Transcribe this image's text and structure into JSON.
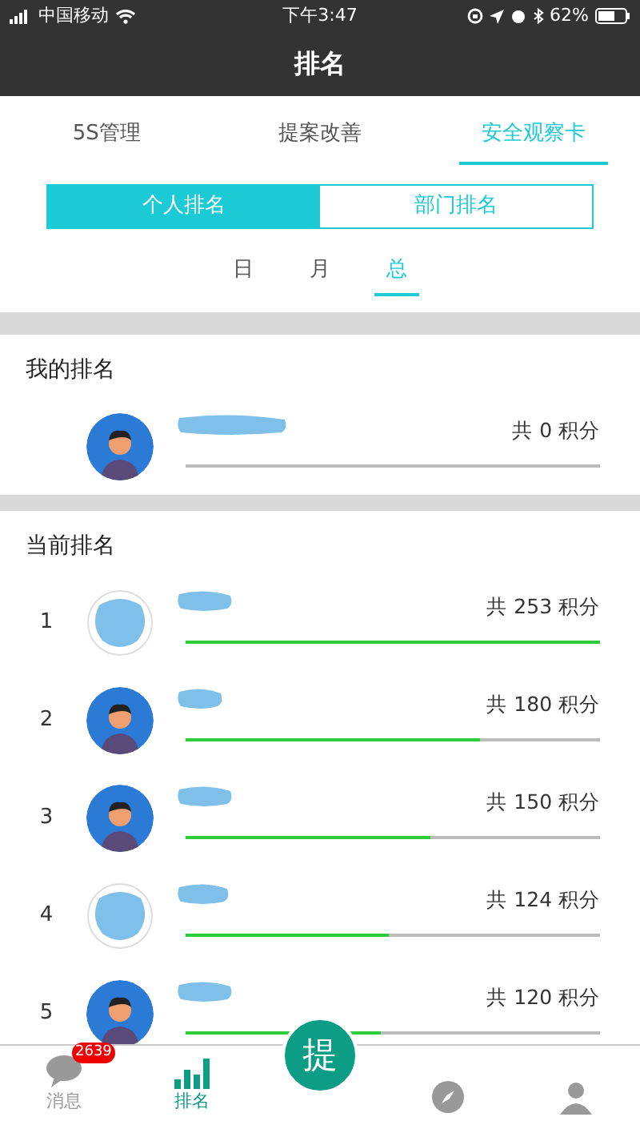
{
  "status_bar": {
    "carrier": "中国移动",
    "time": "下午3:47",
    "battery": "62%"
  },
  "header": {
    "title": "排名"
  },
  "tabs": [
    {
      "label": "5S管理",
      "selected": false
    },
    {
      "label": "提案改善",
      "selected": false
    },
    {
      "label": "安全观察卡",
      "selected": true
    }
  ],
  "segments": [
    {
      "label": "个人排名",
      "selected": true
    },
    {
      "label": "部门排名",
      "selected": false
    }
  ],
  "periods": [
    {
      "label": "日",
      "selected": false
    },
    {
      "label": "月",
      "selected": false
    },
    {
      "label": "总",
      "selected": true
    }
  ],
  "my_ranking": {
    "title": "我的排名",
    "entry": {
      "kind": "person",
      "score": "共 0 积分",
      "level": 0
    }
  },
  "current_ranking": {
    "title": "当前排名",
    "entries": [
      {
        "rank": "1",
        "kind": "blurred",
        "score": "共 253 积分",
        "level": 1
      },
      {
        "rank": "2",
        "kind": "person",
        "score": "共 180 积分",
        "level": 0.71
      },
      {
        "rank": "3",
        "kind": "person",
        "score": "共 150 积分",
        "level": 0.59
      },
      {
        "rank": "4",
        "kind": "blurred",
        "score": "共 124 积分",
        "level": 0.49
      },
      {
        "rank": "5",
        "kind": "person",
        "score": "共 120 积分",
        "level": 0.47
      }
    ]
  },
  "bottom_nav": [
    {
      "kind": "chat",
      "label": "消息",
      "badge": "2639",
      "selected": false
    },
    {
      "kind": "chart",
      "label": "排名",
      "selected": true
    },
    {
      "kind": "center",
      "label": "提",
      "selected": false
    },
    {
      "kind": "compass",
      "selected": false
    },
    {
      "kind": "person",
      "selected": false
    }
  ]
}
